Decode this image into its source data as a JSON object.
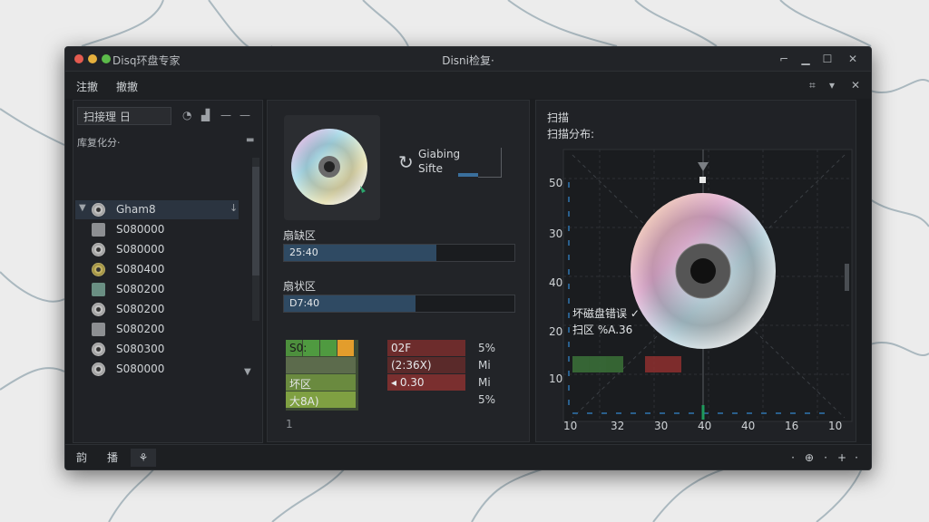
{
  "window": {
    "title_left": "Disq环盘专家",
    "title_center": "Disni检复·"
  },
  "menu": {
    "items": [
      "注撤",
      "撤撤"
    ]
  },
  "sidebar": {
    "search_value": "扫接理 日",
    "tree_header": "库复化分·",
    "items": [
      {
        "label": "Gham8",
        "selected": true
      },
      {
        "label": "S080000",
        "selected": false
      },
      {
        "label": "S080000",
        "selected": false
      },
      {
        "label": "S080400",
        "selected": false
      },
      {
        "label": "S080200",
        "selected": false
      },
      {
        "label": "S080200",
        "selected": false
      },
      {
        "label": "S080200",
        "selected": false
      },
      {
        "label": "S080300",
        "selected": false
      },
      {
        "label": "S080000",
        "selected": false
      }
    ]
  },
  "middle": {
    "status_line1": "Giabing",
    "status_line2": "Sifte",
    "bar1": {
      "label": "扇缺区",
      "text": "25:40",
      "fraction": 0.66
    },
    "bar2": {
      "label": "扇状区",
      "text": "D7:40",
      "fraction": 0.57
    },
    "grid_texts": {
      "g1": "S0:",
      "g2": "坏区",
      "g3": "大8A)",
      "r1": "02F",
      "r2": "(2:36X)",
      "r3": "◂ 0.30",
      "m1": "5%",
      "m2": "Mi",
      "m3": "Mi",
      "m4": "5%"
    },
    "dot_label": "1"
  },
  "right": {
    "title1": "扫描",
    "title2": "扫描分布:",
    "yticks": [
      "50",
      "30",
      "40",
      "20",
      "10"
    ],
    "xticks": [
      "10",
      "32",
      "30",
      "40",
      "40",
      "16",
      "10"
    ],
    "overlay1": "坏磁盘错误 ✓",
    "overlay2": "扫区 %A.36"
  },
  "bottom": {
    "left_btns": [
      "韵",
      "播",
      "⚘"
    ],
    "right_icons": [
      "·",
      "⊕",
      "·",
      "+",
      "·"
    ]
  }
}
